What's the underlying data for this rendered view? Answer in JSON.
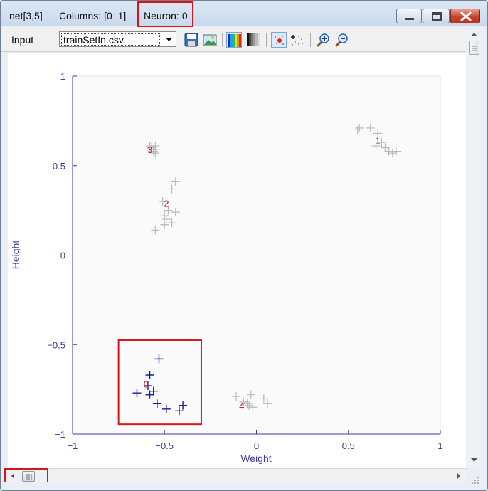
{
  "window": {
    "title_net": "net[3,5]",
    "title_columns_label": "Columns:",
    "title_columns_value": "[0  1]",
    "title_neuron_label": "Neuron:",
    "title_neuron_value": "0",
    "buttons": [
      "minimize-icon",
      "maximize-icon",
      "close-icon"
    ]
  },
  "toolbar": {
    "input_label": "Input",
    "file_value": "trainSetIn.csv",
    "tools": [
      "save-icon",
      "image-icon",
      "color-map-icon",
      "grayscale-map-icon",
      "show-points-icon",
      "scatter-icon",
      "zoom-in-icon",
      "zoom-out-icon"
    ]
  },
  "colors": {
    "axis": "#3a3a9e",
    "selected_point": "#1a1aa8",
    "other_point": "#b8b8b8",
    "cluster_label": "#c01818",
    "highlight_box": "#d7151a"
  },
  "chart_data": {
    "type": "scatter",
    "xlabel": "Weight",
    "ylabel": "Height",
    "xlim": [
      -1,
      1
    ],
    "ylim": [
      -1,
      1
    ],
    "xticks": [
      "−1",
      "−0.5",
      "0",
      "0.5",
      "1"
    ],
    "yticks": [
      "1",
      "0.5",
      "0",
      "−0.5",
      "−1"
    ],
    "grid": false,
    "selected_neuron": 0,
    "selection_box": {
      "x": [
        -0.75,
        -0.3
      ],
      "y": [
        -0.945,
        -0.475
      ]
    },
    "clusters": [
      {
        "label": "0",
        "label_pos": [
          -0.6,
          -0.72
        ],
        "selected": true,
        "points": [
          [
            -0.53,
            -0.58
          ],
          [
            -0.58,
            -0.67
          ],
          [
            -0.59,
            -0.73
          ],
          [
            -0.56,
            -0.76
          ],
          [
            -0.58,
            -0.78
          ],
          [
            -0.65,
            -0.77
          ],
          [
            -0.54,
            -0.83
          ],
          [
            -0.49,
            -0.86
          ],
          [
            -0.42,
            -0.87
          ],
          [
            -0.4,
            -0.84
          ]
        ]
      },
      {
        "label": "1",
        "label_pos": [
          0.66,
          0.64
        ],
        "points": [
          [
            0.55,
            0.7
          ],
          [
            0.56,
            0.71
          ],
          [
            0.62,
            0.71
          ],
          [
            0.66,
            0.68
          ],
          [
            0.65,
            0.61
          ],
          [
            0.68,
            0.63
          ],
          [
            0.7,
            0.6
          ],
          [
            0.72,
            0.58
          ],
          [
            0.74,
            0.57
          ],
          [
            0.76,
            0.58
          ]
        ]
      },
      {
        "label": "2",
        "label_pos": [
          -0.49,
          0.29
        ],
        "points": [
          [
            -0.44,
            0.41
          ],
          [
            -0.46,
            0.37
          ],
          [
            -0.51,
            0.3
          ],
          [
            -0.5,
            0.22
          ],
          [
            -0.49,
            0.2
          ],
          [
            -0.48,
            0.25
          ],
          [
            -0.44,
            0.24
          ],
          [
            -0.46,
            0.18
          ],
          [
            -0.5,
            0.17
          ],
          [
            -0.55,
            0.14
          ]
        ]
      },
      {
        "label": "3",
        "label_pos": [
          -0.58,
          0.59
        ],
        "points": [
          [
            -0.58,
            0.61
          ],
          [
            -0.55,
            0.61
          ],
          [
            -0.57,
            0.6
          ],
          [
            -0.56,
            0.59
          ],
          [
            -0.55,
            0.57
          ],
          [
            -0.56,
            0.58
          ],
          [
            -0.57,
            0.61
          ]
        ]
      },
      {
        "label": "4",
        "label_pos": [
          -0.08,
          -0.84
        ],
        "points": [
          [
            -0.11,
            -0.79
          ],
          [
            -0.03,
            -0.78
          ],
          [
            -0.07,
            -0.82
          ],
          [
            -0.04,
            -0.84
          ],
          [
            0.04,
            -0.8
          ],
          [
            0.06,
            -0.83
          ],
          [
            -0.02,
            -0.85
          ],
          [
            -0.05,
            -0.83
          ]
        ]
      }
    ]
  }
}
